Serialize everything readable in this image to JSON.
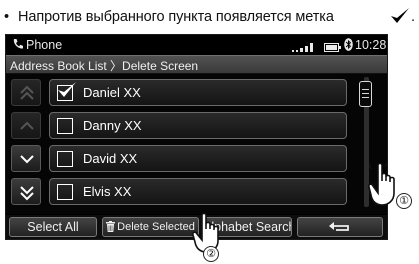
{
  "caption": {
    "bullet": "•",
    "text": "Напротив выбранного пункта появляется метка",
    "trailing": "."
  },
  "statusbar": {
    "app_title": "Phone",
    "clock": "10:28",
    "icons": [
      "phone-icon",
      "signal-icon",
      "battery-icon",
      "bluetooth-icon"
    ]
  },
  "breadcrumb": "Address Book List 〉Delete Screen",
  "contacts": [
    {
      "name": "Daniel XX",
      "checked": true
    },
    {
      "name": "Danny XX",
      "checked": false
    },
    {
      "name": "David XX",
      "checked": false
    },
    {
      "name": "Elvis XX",
      "checked": false
    }
  ],
  "bottom_buttons": {
    "select_all": "Select All",
    "delete_selected": "Delete Selected",
    "alphabet_search": "Alphabet Search"
  },
  "callouts": {
    "first": "①",
    "second": "②"
  },
  "colors": {
    "screen_bg": "#000000",
    "text": "#ffffff",
    "border": "#6a6a6a"
  }
}
